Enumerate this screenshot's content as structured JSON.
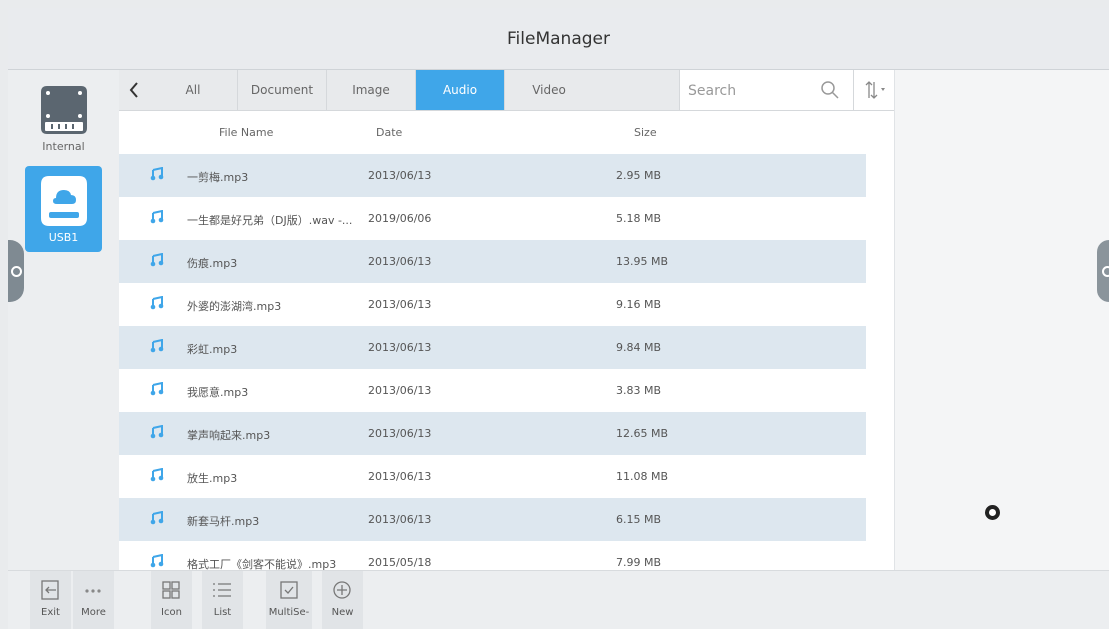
{
  "window": {
    "title": "FileManager"
  },
  "devices": [
    {
      "label": "Internal",
      "icon": "hard-drive-icon",
      "selected": false
    },
    {
      "label": "USB1",
      "icon": "usb-drive-icon",
      "selected": true
    }
  ],
  "tabs": [
    {
      "label": "All",
      "active": false
    },
    {
      "label": "Document",
      "active": false
    },
    {
      "label": "Image",
      "active": false
    },
    {
      "label": "Audio",
      "active": true
    },
    {
      "label": "Video",
      "active": false
    }
  ],
  "search": {
    "placeholder": "Search"
  },
  "columns": {
    "name": "File Name",
    "date": "Date",
    "size": "Size"
  },
  "files": [
    {
      "name": "一剪梅.mp3",
      "date": "2013/06/13",
      "size": "2.95 MB"
    },
    {
      "name": "一生都是好兄弟（DJ版）.wav -...",
      "date": "2019/06/06",
      "size": "5.18 MB"
    },
    {
      "name": "伤痕.mp3",
      "date": "2013/06/13",
      "size": "13.95 MB"
    },
    {
      "name": "外婆的澎湖湾.mp3",
      "date": "2013/06/13",
      "size": "9.16 MB"
    },
    {
      "name": "彩虹.mp3",
      "date": "2013/06/13",
      "size": "9.84 MB"
    },
    {
      "name": "我愿意.mp3",
      "date": "2013/06/13",
      "size": "3.83 MB"
    },
    {
      "name": "掌声响起来.mp3",
      "date": "2013/06/13",
      "size": "12.65 MB"
    },
    {
      "name": "放生.mp3",
      "date": "2013/06/13",
      "size": "11.08 MB"
    },
    {
      "name": "新套马杆.mp3",
      "date": "2013/06/13",
      "size": "6.15 MB"
    },
    {
      "name": "格式工厂《剑客不能说》.mp3",
      "date": "2015/05/18",
      "size": "7.99 MB"
    }
  ],
  "toolbar": {
    "exit": "Exit",
    "more": "More",
    "icon_view": "Icon",
    "list_view": "List",
    "multi_select": "MultiSe-",
    "new": "New"
  },
  "colors": {
    "accent": "#3fa6e9",
    "row_shade": "#dde7ef",
    "note_icon": "#3fa6e9"
  }
}
